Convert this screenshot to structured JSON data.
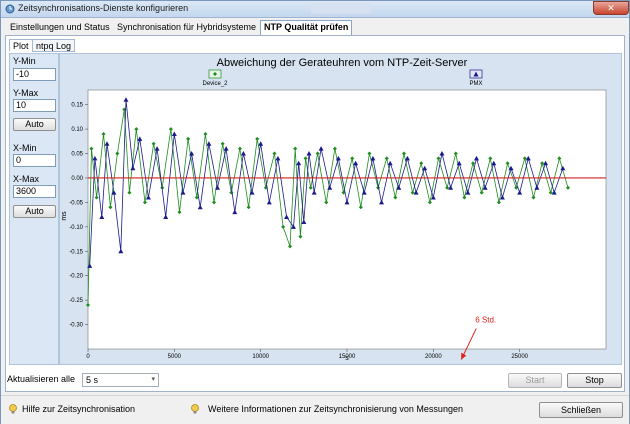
{
  "window": {
    "title": "Zeitsynchronisations-Dienste konfigurieren",
    "close_glyph": "✕"
  },
  "main_tabs": [
    {
      "label": "Einstellungen und Status"
    },
    {
      "label": "Synchronisation für Hybridsysteme"
    },
    {
      "label": "NTP Qualität prüfen"
    }
  ],
  "sub_tabs": [
    {
      "label": "Plot"
    },
    {
      "label": "ntpq Log"
    }
  ],
  "sidebar": {
    "ymin_label": "Y-Min",
    "ymin_value": "-10",
    "ymax_label": "Y-Max",
    "ymax_value": "10",
    "y_auto": "Auto",
    "xmin_label": "X-Min",
    "xmin_value": "0",
    "xmax_label": "X-Max",
    "xmax_value": "3600",
    "x_auto": "Auto"
  },
  "chart_data": {
    "type": "line",
    "title": "Abweichung der Gerateuhren vom NTP-Zeit-Server",
    "xlabel": "s",
    "ylabel": "ms",
    "xlim": [
      0,
      30000
    ],
    "ylim": [
      -0.35,
      0.18
    ],
    "xticks": [
      0,
      5000,
      10000,
      15000,
      20000,
      25000
    ],
    "yticks": [
      0.15,
      0.1,
      0.05,
      0.0,
      -0.05,
      -0.1,
      -0.15,
      -0.2,
      -0.25,
      -0.3
    ],
    "ytick_labels": [
      "0.15",
      "0.10",
      "0.05",
      "0.00",
      "-0.05",
      "-0.10",
      "-0.15",
      "-0.20",
      "-0.25",
      "-0.30"
    ],
    "grid": false,
    "legend_position": "top",
    "series": [
      {
        "name": "Device_2",
        "color": "#1e8c1e",
        "marker": "diamond",
        "x": [
          0,
          200,
          500,
          900,
          1300,
          1700,
          2100,
          2400,
          2800,
          3300,
          3800,
          4300,
          4800,
          5300,
          5800,
          6300,
          6800,
          7300,
          7800,
          8300,
          8800,
          9300,
          9800,
          10300,
          10800,
          11300,
          11700,
          12000,
          12300,
          12600,
          12900,
          13300,
          13800,
          14300,
          14800,
          15300,
          15800,
          16300,
          16800,
          17300,
          17800,
          18300,
          18800,
          19300,
          19800,
          20300,
          20800,
          21300,
          21800,
          22300,
          22800,
          23300,
          23800,
          24300,
          24800,
          25300,
          25800,
          26300,
          26800,
          27300,
          27800
        ],
        "y": [
          -0.26,
          0.06,
          -0.04,
          0.09,
          -0.06,
          0.05,
          0.14,
          -0.03,
          0.1,
          -0.05,
          0.07,
          -0.02,
          0.1,
          -0.07,
          0.08,
          -0.04,
          0.09,
          -0.05,
          0.07,
          -0.03,
          0.06,
          -0.06,
          0.08,
          -0.02,
          0.05,
          -0.1,
          -0.14,
          0.06,
          -0.12,
          0.04,
          -0.02,
          0.05,
          -0.05,
          0.06,
          -0.03,
          0.04,
          -0.06,
          0.05,
          -0.02,
          0.04,
          -0.04,
          0.05,
          -0.03,
          0.03,
          -0.05,
          0.04,
          -0.02,
          0.05,
          -0.04,
          0.03,
          -0.03,
          0.04,
          -0.05,
          0.03,
          -0.02,
          0.04,
          -0.04,
          0.03,
          -0.03,
          0.04,
          -0.02
        ]
      },
      {
        "name": "PMX",
        "color": "#1a1a8c",
        "marker": "triangle",
        "x": [
          100,
          400,
          800,
          1100,
          1500,
          1900,
          2200,
          2600,
          3000,
          3500,
          4000,
          4500,
          5000,
          5500,
          6000,
          6500,
          7000,
          7500,
          8000,
          8500,
          9000,
          9500,
          10000,
          10500,
          11000,
          11500,
          11900,
          12200,
          12500,
          12800,
          13100,
          13500,
          14000,
          14500,
          15000,
          15500,
          16000,
          16500,
          17000,
          17500,
          18000,
          18500,
          19000,
          19500,
          20000,
          20500,
          21000,
          21500,
          22000,
          22500,
          23000,
          23500,
          24000,
          24500,
          25000,
          25500,
          26000,
          26500,
          27000,
          27500
        ],
        "y": [
          -0.18,
          0.04,
          -0.08,
          0.07,
          -0.03,
          -0.15,
          0.16,
          0.02,
          0.08,
          -0.04,
          0.06,
          -0.08,
          0.09,
          -0.03,
          0.05,
          -0.06,
          0.07,
          -0.02,
          0.06,
          -0.07,
          0.05,
          -0.03,
          0.07,
          -0.05,
          0.04,
          -0.08,
          -0.1,
          0.03,
          -0.09,
          0.05,
          -0.03,
          0.06,
          -0.02,
          0.04,
          -0.05,
          0.03,
          -0.03,
          0.04,
          -0.05,
          0.03,
          -0.02,
          0.04,
          -0.03,
          0.02,
          -0.04,
          0.05,
          -0.02,
          0.03,
          -0.03,
          0.04,
          -0.02,
          0.03,
          -0.04,
          0.02,
          -0.03,
          0.04,
          -0.02,
          0.03,
          -0.03,
          0.02
        ]
      }
    ],
    "annotation": {
      "text": "6 Std.",
      "x": 21500,
      "y": -0.3,
      "color": "#e0201a"
    }
  },
  "bottom": {
    "refresh_label": "Aktualisieren alle",
    "refresh_value": "5 s",
    "start_label": "Start",
    "stop_label": "Stop"
  },
  "footer": {
    "help_link": "Hilfe zur Zeitsynchronisation",
    "info_link": "Weitere Informationen zur Zeitsynchronisierung von Messungen",
    "close_label": "Schließen"
  }
}
